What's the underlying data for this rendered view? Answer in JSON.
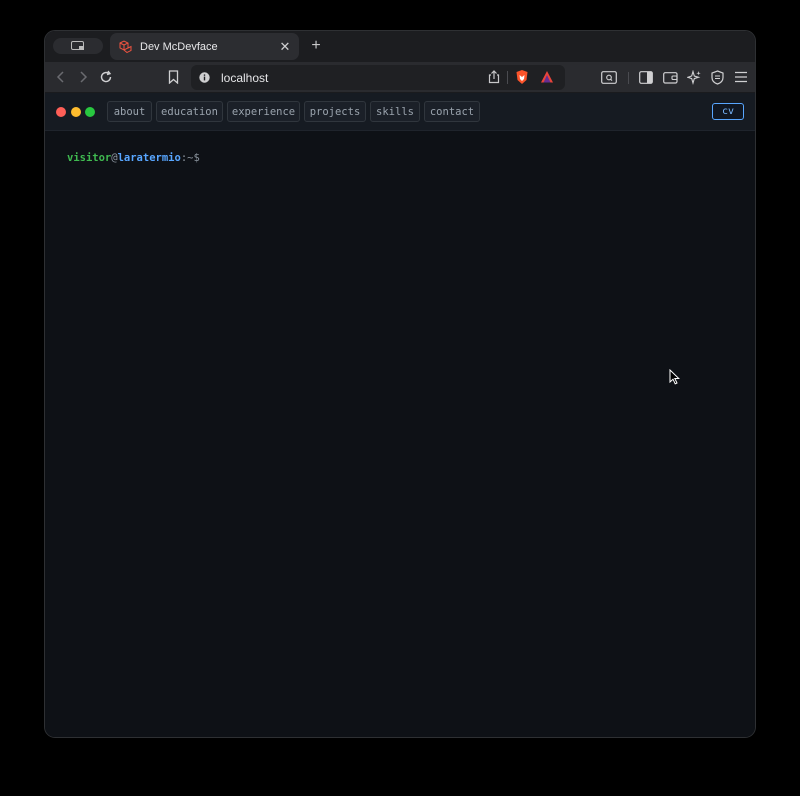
{
  "browser": {
    "tab": {
      "title": "Dev McDevface",
      "close_icon": "close-icon"
    },
    "url": "localhost",
    "icons": [
      "sidebar-toggle-icon",
      "back-icon",
      "forward-icon",
      "reload-icon",
      "bookmark-icon",
      "info-icon",
      "share-icon",
      "brave-shields-icon",
      "brave-rewards-icon",
      "reader-mode-icon",
      "sidebar-icon",
      "wallet-icon",
      "leo-ai-icon",
      "vpn-icon",
      "menu-icon"
    ]
  },
  "terminal": {
    "nav": [
      "about",
      "education",
      "experience",
      "projects",
      "skills",
      "contact"
    ],
    "cv_label": "cv",
    "window_dots": {
      "close": "#ff5f57",
      "minimize": "#febc2e",
      "maximize": "#28c840"
    },
    "prompt": {
      "user": "visitor",
      "at": "@",
      "host": "laratermio",
      "path": ":~$"
    }
  },
  "colors": {
    "accent": "#58a6ff",
    "prompt_user": "#3fb950",
    "background": "#0e1116"
  }
}
